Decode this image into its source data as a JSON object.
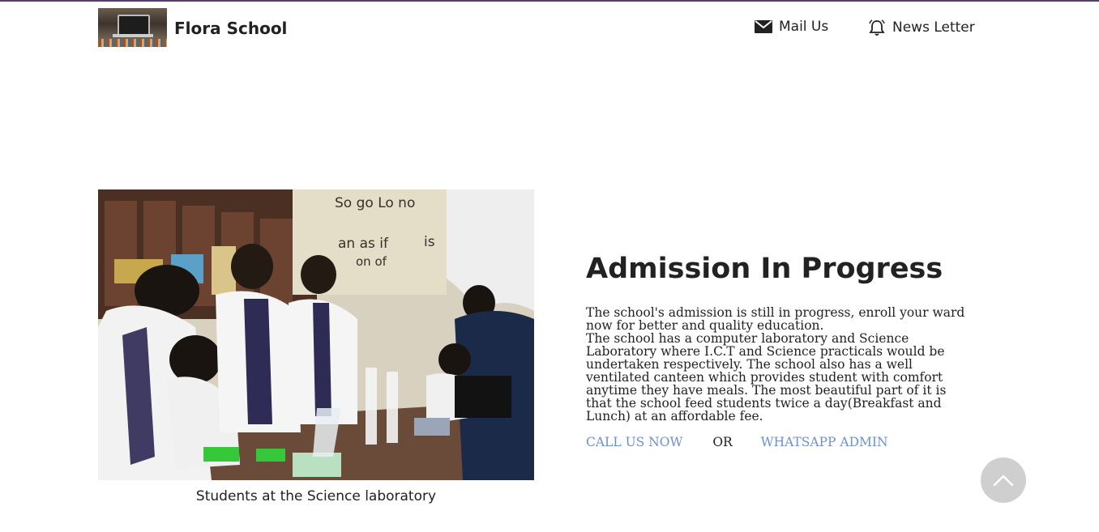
{
  "header": {
    "brand": "Flora School",
    "nav": {
      "mail_label": "Mail Us",
      "newsletter_label": "News Letter"
    }
  },
  "hero": {
    "caption": "Students at the Science laboratory",
    "board_words": [
      "So go Lo no",
      "an as if",
      "is",
      "on of"
    ]
  },
  "admission": {
    "title": "Admission In Progress",
    "paragraph_1": "The school's admission is still in progress, enroll your ward now for better and quality education.",
    "paragraph_2": "The school has a computer laboratory and Science Laboratory where I.C.T  and Science practicals would be undertaken respectively. The school also has a well ventilated canteen which provides student with comfort anytime they have meals. The most beautiful part of it is that the school feed students twice a day(Breakfast and Lunch) at an affordable fee.",
    "call_label": "CALL US NOW",
    "or_label": "OR",
    "whatsapp_label": "WHATSAPP ADMIN"
  },
  "icons": {
    "mail": "mail-icon",
    "newsletter": "bell-icon",
    "scroll_top": "chevron-up-icon"
  },
  "colors": {
    "top_border": "#5b3a6e",
    "link": "#6b8fd6",
    "scroll_button": "#cfcfcf"
  }
}
